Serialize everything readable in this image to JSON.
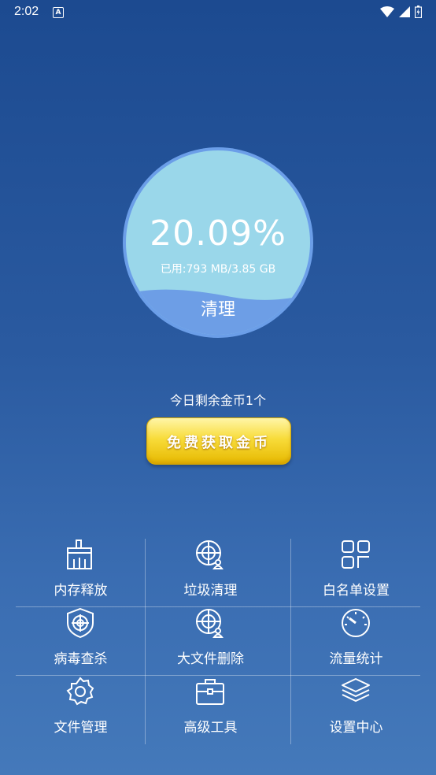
{
  "status_bar": {
    "time": "2:02",
    "notification_badge": "A",
    "icons": [
      "wifi-icon",
      "signal-icon",
      "battery-icon"
    ]
  },
  "gauge": {
    "percent": "20.09%",
    "used_text": "已用:793 MB/3.85 GB",
    "clean_label": "清理",
    "fill_fraction": 0.2009,
    "colors": {
      "inner": "#9ad7ea",
      "ring": "#6b9ee8",
      "wave": "#6d9ee6"
    }
  },
  "coins": {
    "remaining_text": "今日剩余金币1个",
    "button_label": "免费获取金币"
  },
  "tools": [
    {
      "label": "内存释放",
      "icon": "broom-icon"
    },
    {
      "label": "垃圾清理",
      "icon": "radar-user-icon"
    },
    {
      "label": "白名单设置",
      "icon": "apps-grid-icon"
    },
    {
      "label": "病毒查杀",
      "icon": "shield-target-icon"
    },
    {
      "label": "大文件删除",
      "icon": "radar-user-icon"
    },
    {
      "label": "流量统计",
      "icon": "speedometer-icon"
    },
    {
      "label": "文件管理",
      "icon": "gear-icon"
    },
    {
      "label": "高级工具",
      "icon": "toolbox-icon"
    },
    {
      "label": "设置中心",
      "icon": "layers-icon"
    }
  ]
}
